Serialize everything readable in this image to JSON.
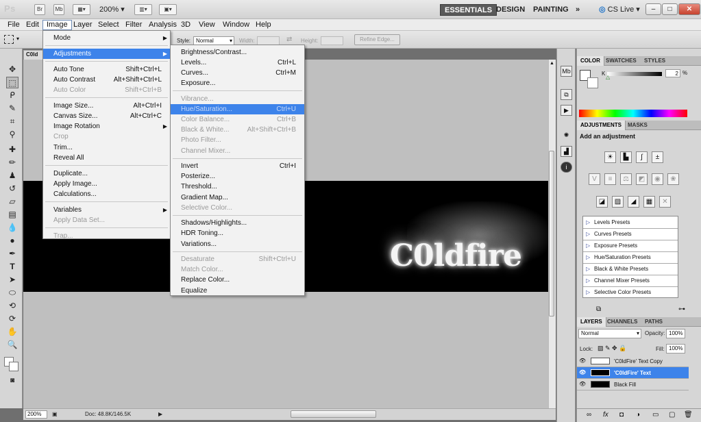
{
  "titlebar": {
    "app_logo": "Ps",
    "br_label": "Br",
    "mb_label": "Mb",
    "zoom": "200%",
    "workspaces": [
      "ESSENTIALS",
      "DESIGN",
      "PAINTING"
    ],
    "more": "»",
    "cs_live": "CS Live",
    "win_controls": [
      "–",
      "□",
      "✕"
    ]
  },
  "menubar": [
    "File",
    "Edit",
    "Image",
    "Layer",
    "Select",
    "Filter",
    "Analysis",
    "3D",
    "View",
    "Window",
    "Help"
  ],
  "options": {
    "style_label": "Style:",
    "style_value": "Normal",
    "width_label": "Width:",
    "height_label": "Height:",
    "refine_edge": "Refine Edge..."
  },
  "document": {
    "tab": "C0ld",
    "canvas_text": "C0ldfire",
    "zoom": "200%",
    "doc_info": "Doc: 48.8K/146.5K"
  },
  "image_menu": {
    "items": [
      {
        "label": "Mode",
        "sub": true
      },
      {
        "sep": true
      },
      {
        "label": "Adjustments",
        "sub": true,
        "highlight": true
      },
      {
        "sep": true
      },
      {
        "label": "Auto Tone",
        "shortcut": "Shift+Ctrl+L"
      },
      {
        "label": "Auto Contrast",
        "shortcut": "Alt+Shift+Ctrl+L"
      },
      {
        "label": "Auto Color",
        "shortcut": "Shift+Ctrl+B",
        "disabled": true
      },
      {
        "sep": true
      },
      {
        "label": "Image Size...",
        "shortcut": "Alt+Ctrl+I"
      },
      {
        "label": "Canvas Size...",
        "shortcut": "Alt+Ctrl+C"
      },
      {
        "label": "Image Rotation",
        "sub": true
      },
      {
        "label": "Crop",
        "disabled": true
      },
      {
        "label": "Trim..."
      },
      {
        "label": "Reveal All"
      },
      {
        "sep": true
      },
      {
        "label": "Duplicate..."
      },
      {
        "label": "Apply Image..."
      },
      {
        "label": "Calculations..."
      },
      {
        "sep": true
      },
      {
        "label": "Variables",
        "sub": true
      },
      {
        "label": "Apply Data Set...",
        "disabled": true
      },
      {
        "sep": true
      },
      {
        "label": "Trap...",
        "disabled": true
      }
    ]
  },
  "adjust_menu": {
    "items": [
      {
        "label": "Brightness/Contrast..."
      },
      {
        "label": "Levels...",
        "shortcut": "Ctrl+L"
      },
      {
        "label": "Curves...",
        "shortcut": "Ctrl+M"
      },
      {
        "label": "Exposure..."
      },
      {
        "sep": true
      },
      {
        "label": "Vibrance...",
        "disabled": true
      },
      {
        "label": "Hue/Saturation...",
        "shortcut": "Ctrl+U",
        "disabled": true,
        "highlight": true
      },
      {
        "label": "Color Balance...",
        "shortcut": "Ctrl+B",
        "disabled": true
      },
      {
        "label": "Black & White...",
        "shortcut": "Alt+Shift+Ctrl+B",
        "disabled": true
      },
      {
        "label": "Photo Filter...",
        "disabled": true
      },
      {
        "label": "Channel Mixer...",
        "disabled": true
      },
      {
        "sep": true
      },
      {
        "label": "Invert",
        "shortcut": "Ctrl+I"
      },
      {
        "label": "Posterize..."
      },
      {
        "label": "Threshold..."
      },
      {
        "label": "Gradient Map..."
      },
      {
        "label": "Selective Color...",
        "disabled": true
      },
      {
        "sep": true
      },
      {
        "label": "Shadows/Highlights..."
      },
      {
        "label": "HDR Toning..."
      },
      {
        "label": "Variations..."
      },
      {
        "sep": true
      },
      {
        "label": "Desaturate",
        "shortcut": "Shift+Ctrl+U",
        "disabled": true
      },
      {
        "label": "Match Color...",
        "disabled": true
      },
      {
        "label": "Replace Color..."
      },
      {
        "label": "Equalize"
      }
    ]
  },
  "color_panel": {
    "tabs": [
      "COLOR",
      "SWATCHES",
      "STYLES"
    ],
    "k_label": "K",
    "k_value": "2",
    "k_unit": "%"
  },
  "adjustments_panel": {
    "tabs": [
      "ADJUSTMENTS",
      "MASKS"
    ],
    "heading": "Add an adjustment",
    "presets": [
      "Levels Presets",
      "Curves Presets",
      "Exposure Presets",
      "Hue/Saturation Presets",
      "Black & White Presets",
      "Channel Mixer Presets",
      "Selective Color Presets"
    ]
  },
  "layers_panel": {
    "tabs": [
      "LAYERS",
      "CHANNELS",
      "PATHS"
    ],
    "blend_mode": "Normal",
    "opacity_label": "Opacity:",
    "opacity_value": "100%",
    "lock_label": "Lock:",
    "fill_label": "Fill:",
    "fill_value": "100%",
    "layers": [
      {
        "name": "'C0ldFire' Text Copy"
      },
      {
        "name": "'C0ldFire' Text",
        "selected": true
      },
      {
        "name": "Black Fill"
      }
    ]
  }
}
